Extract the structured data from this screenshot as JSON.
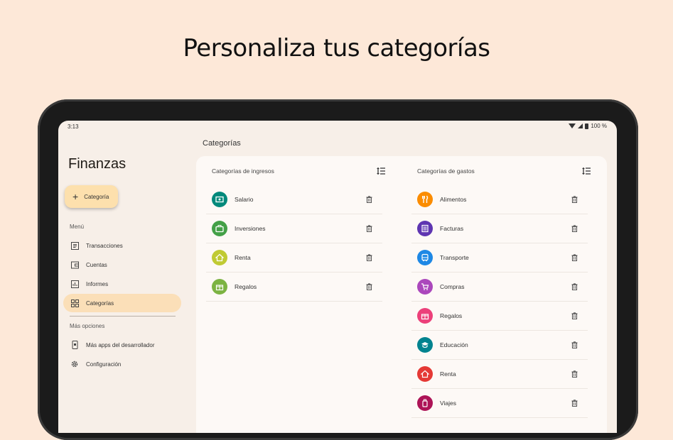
{
  "headline": "Personaliza tus categorías",
  "status_bar": {
    "time": "3:13",
    "battery": "100 %"
  },
  "sidebar": {
    "app_title": "Finanzas",
    "fab_label": "Categoría",
    "menu_label": "Menú",
    "items": [
      {
        "label": "Transacciones",
        "icon": "receipt-icon"
      },
      {
        "label": "Cuentas",
        "icon": "wallet-icon"
      },
      {
        "label": "Informes",
        "icon": "chart-icon"
      },
      {
        "label": "Categorías",
        "icon": "grid-icon",
        "active": true
      }
    ],
    "more_label": "Más opciones",
    "more_items": [
      {
        "label": "Más apps del desarrollador",
        "icon": "phone-apps-icon"
      },
      {
        "label": "Configuración",
        "icon": "gear-icon"
      }
    ]
  },
  "main": {
    "title": "Categorías",
    "income": {
      "heading": "Categorías de ingresos",
      "items": [
        {
          "label": "Salario",
          "color": "#00897b",
          "icon": "money-icon"
        },
        {
          "label": "Inversiones",
          "color": "#43a047",
          "icon": "briefcase-icon"
        },
        {
          "label": "Renta",
          "color": "#c0ca33",
          "icon": "home-icon"
        },
        {
          "label": "Regalos",
          "color": "#7cb342",
          "icon": "gift-icon"
        }
      ]
    },
    "expense": {
      "heading": "Categorías de gastos",
      "items": [
        {
          "label": "Alimentos",
          "color": "#fb8c00",
          "icon": "restaurant-icon"
        },
        {
          "label": "Facturas",
          "color": "#5e35b1",
          "icon": "bill-icon"
        },
        {
          "label": "Transporte",
          "color": "#1e88e5",
          "icon": "bus-icon"
        },
        {
          "label": "Compras",
          "color": "#ab47bc",
          "icon": "cart-icon"
        },
        {
          "label": "Regalos",
          "color": "#ec407a",
          "icon": "gift-icon"
        },
        {
          "label": "Educación",
          "color": "#00838f",
          "icon": "school-icon"
        },
        {
          "label": "Renta",
          "color": "#e53935",
          "icon": "home-icon"
        },
        {
          "label": "Viajes",
          "color": "#ad1457",
          "icon": "luggage-icon"
        }
      ]
    }
  },
  "colors": {
    "background": "#fde8d8",
    "accent": "#fbdfb8",
    "fab": "#fde0ad"
  }
}
